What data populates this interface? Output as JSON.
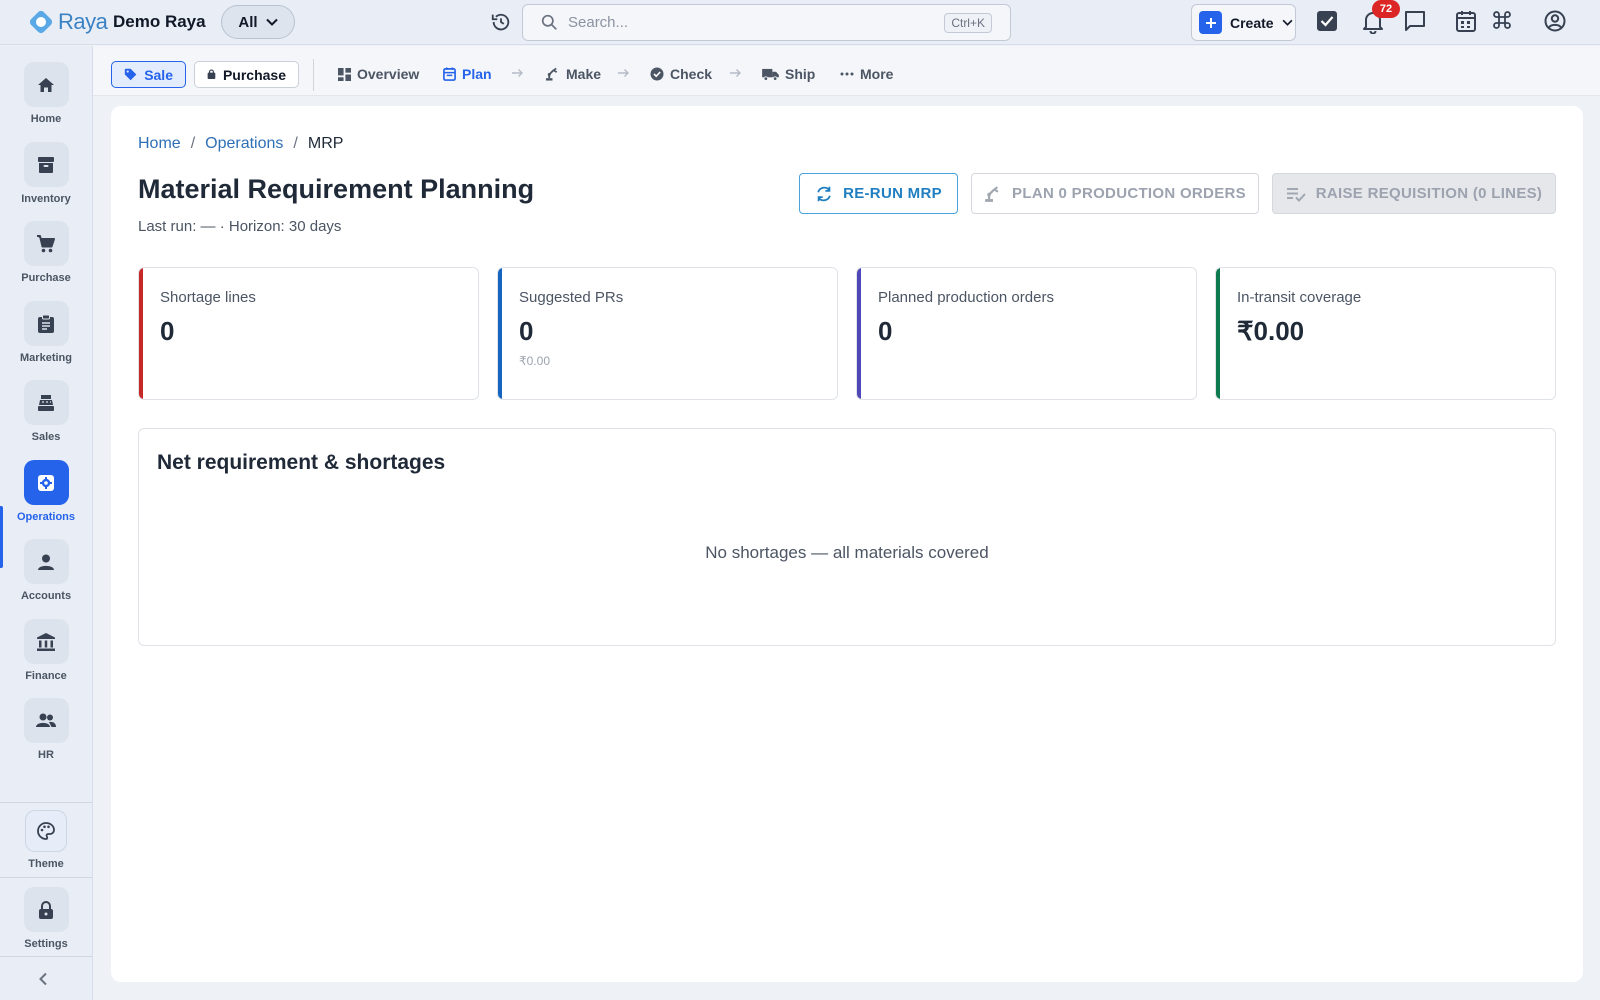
{
  "app": {
    "brand": "Raya",
    "company": "Demo Raya",
    "scope": "All",
    "search_placeholder": "Search...",
    "search_shortcut": "Ctrl+K",
    "create_label": "Create",
    "notification_count": "72"
  },
  "sidebar": {
    "items": [
      {
        "label": "Home",
        "icon": "home-icon"
      },
      {
        "label": "Inventory",
        "icon": "archive-icon"
      },
      {
        "label": "Purchase",
        "icon": "cart-icon"
      },
      {
        "label": "Marketing",
        "icon": "clipboard-icon"
      },
      {
        "label": "Sales",
        "icon": "register-icon"
      },
      {
        "label": "Operations",
        "icon": "gear-icon",
        "active": true
      },
      {
        "label": "Accounts",
        "icon": "person-icon"
      },
      {
        "label": "Finance",
        "icon": "bank-icon"
      },
      {
        "label": "HR",
        "icon": "people-icon"
      }
    ],
    "theme_label": "Theme",
    "settings_label": "Settings"
  },
  "subnav": {
    "sale": "Sale",
    "purchase": "Purchase",
    "links": [
      "Overview",
      "Plan",
      "Make",
      "Check",
      "Ship",
      "More"
    ],
    "active": "Plan"
  },
  "breadcrumb": {
    "home": "Home",
    "section": "Operations",
    "current": "MRP",
    "separator": "/"
  },
  "page": {
    "title": "Material Requirement Planning",
    "subtitle": "Last run: — · Horizon: 30 days"
  },
  "actions": {
    "rerun": "RE-RUN MRP",
    "plan": "PLAN 0 PRODUCTION ORDERS",
    "raise": "RAISE REQUISITION (0 LINES)"
  },
  "kpis": [
    {
      "label": "Shortage lines",
      "value": "0",
      "sub": "",
      "color": "#c62828"
    },
    {
      "label": "Suggested PRs",
      "value": "0",
      "sub": "₹0.00",
      "color": "#1565c0"
    },
    {
      "label": "Planned production orders",
      "value": "0",
      "sub": "",
      "color": "#4f46b8"
    },
    {
      "label": "In-transit coverage",
      "value": "₹0.00",
      "sub": "",
      "color": "#0d7a4f"
    }
  ],
  "panel": {
    "title": "Net requirement & shortages",
    "empty": "No shortages — all materials covered"
  }
}
